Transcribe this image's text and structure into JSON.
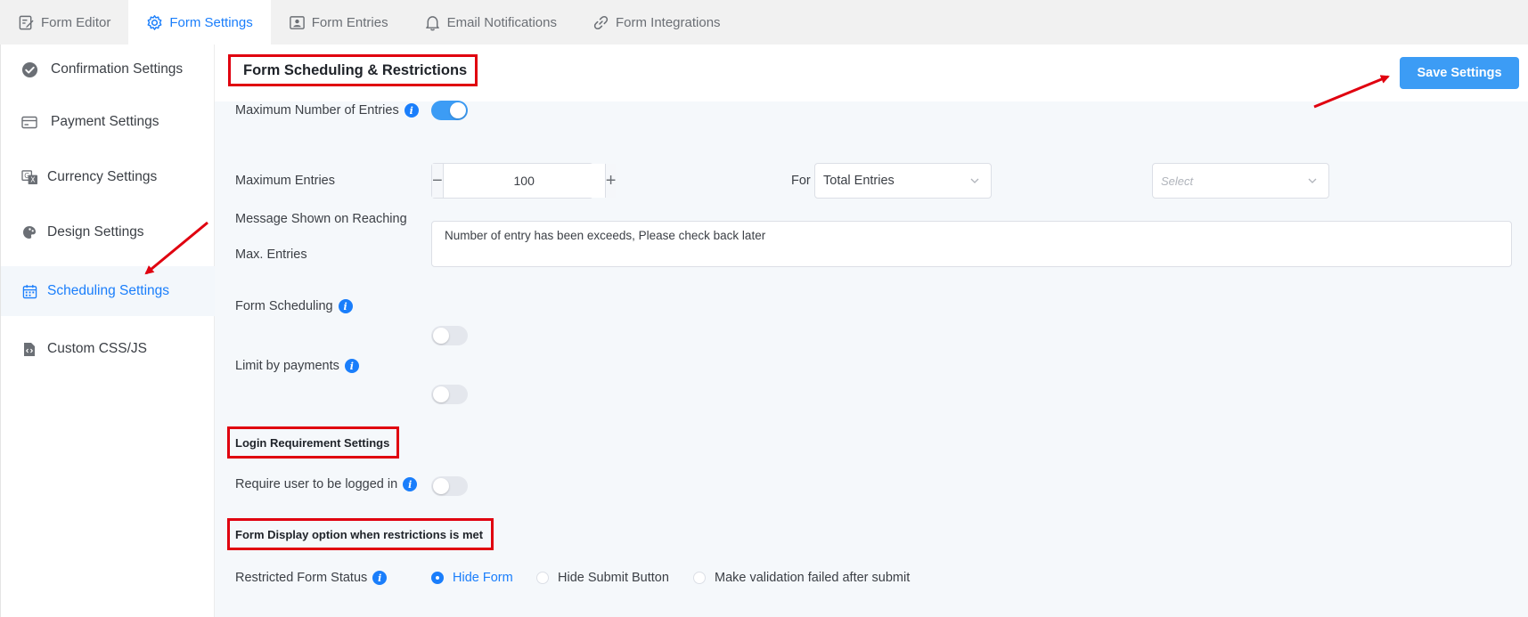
{
  "tabs": [
    {
      "label": "Form Editor",
      "icon": "edit-icon"
    },
    {
      "label": "Form Settings",
      "icon": "gear-icon",
      "active": true
    },
    {
      "label": "Form Entries",
      "icon": "user-card-icon"
    },
    {
      "label": "Email Notifications",
      "icon": "bell-icon"
    },
    {
      "label": "Form Integrations",
      "icon": "link-icon"
    }
  ],
  "sidebar": {
    "items": [
      {
        "label": "Confirmation Settings",
        "icon": "check-circle-icon"
      },
      {
        "label": "Payment Settings",
        "icon": "card-icon"
      },
      {
        "label": "Currency Settings",
        "icon": "currency-icon"
      },
      {
        "label": "Design Settings",
        "icon": "palette-icon"
      },
      {
        "label": "Scheduling Settings",
        "icon": "calendar-icon",
        "active": true
      },
      {
        "label": "Custom CSS/JS",
        "icon": "code-file-icon"
      }
    ]
  },
  "header": {
    "title": "Form Scheduling & Restrictions",
    "save_label": "Save Settings"
  },
  "form": {
    "max_entries_toggle_label": "Maximum Number of Entries",
    "max_entries_toggle_on": true,
    "max_entries_label": "Maximum Entries",
    "max_entries_value": "100",
    "for_label": "For",
    "for_selected": "Total Entries",
    "period_placeholder": "Select",
    "message_label_line1": "Message Shown on Reaching",
    "message_label_line2": "Max. Entries",
    "message_value": "Number of entry has been exceeds, Please check back later",
    "scheduling_label": "Form Scheduling",
    "scheduling_on": false,
    "limit_payments_label": "Limit by payments",
    "limit_payments_on": false,
    "login_section_title": "Login Requirement Settings",
    "require_login_label": "Require user to be logged in",
    "require_login_on": false,
    "display_section_title": "Form Display option when restrictions is met",
    "restricted_status_label": "Restricted Form Status",
    "restricted_options": [
      "Hide Form",
      "Hide Submit Button",
      "Make validation failed after submit"
    ],
    "restricted_selected": "Hide Form"
  },
  "colors": {
    "accent": "#1a7efb",
    "button": "#3c9cf5",
    "annotation_red": "#e0000f"
  }
}
